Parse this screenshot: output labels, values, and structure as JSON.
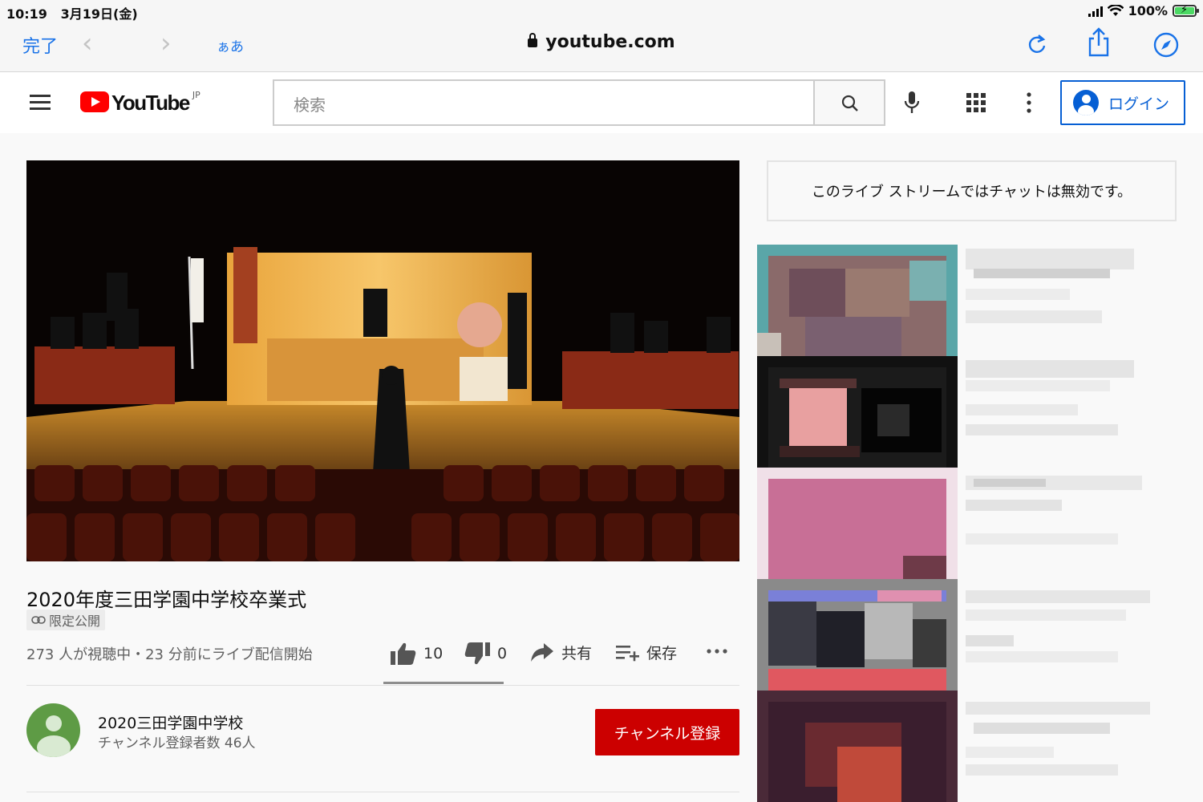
{
  "status_bar": {
    "time": "10:19",
    "date": "3月19日(金)",
    "battery": "100%",
    "battery_level": 1.0
  },
  "safari": {
    "done": "完了",
    "back_glyph": "‹",
    "forward_glyph": "›",
    "text_size": "ぁあ",
    "url": "youtube.com"
  },
  "header": {
    "logo_text": "YouTube",
    "country": "JP",
    "search_placeholder": "検索",
    "login_label": "ログイン"
  },
  "video": {
    "title": "2020年度三田学園中学校卒業式",
    "privacy": "限定公開",
    "meta": "273 人が視聴中・23 分前にライブ配信開始",
    "likes": "10",
    "dislikes": "0",
    "share": "共有",
    "save": "保存"
  },
  "channel": {
    "name": "2020三田学園中学校",
    "subscribers": "チャンネル登録者数 46人",
    "subscribe_label": "チャンネル登録"
  },
  "sidebar": {
    "chat_disabled": "このライブ ストリームではチャットは無効です。"
  },
  "colors": {
    "accent": "#065fd4",
    "brand_red": "#ff0000",
    "subscribe_red": "#cc0000",
    "ios_blue": "#1a73e8"
  }
}
